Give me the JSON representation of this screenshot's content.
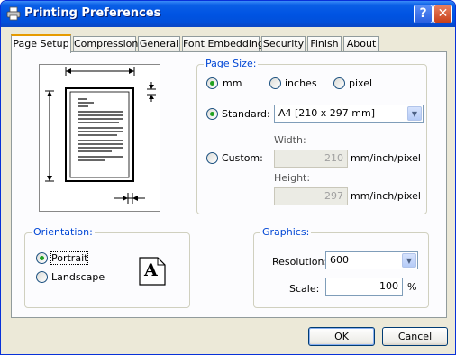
{
  "window": {
    "title": "Printing Preferences",
    "help_glyph": "?",
    "close_glyph": "✕"
  },
  "tabs": [
    {
      "label": "Page Setup",
      "active": true
    },
    {
      "label": "Compression"
    },
    {
      "label": "General"
    },
    {
      "label": "Font Embedding"
    },
    {
      "label": "Security"
    },
    {
      "label": "Finish"
    },
    {
      "label": "About"
    }
  ],
  "page_size": {
    "group_label": "Page Size:",
    "unit_options": [
      {
        "label": "mm",
        "checked": true
      },
      {
        "label": "inches",
        "checked": false
      },
      {
        "label": "pixel",
        "checked": false
      }
    ],
    "standard_label": "Standard:",
    "standard_checked": true,
    "standard_value": "A4 [210 x 297 mm]",
    "custom_label": "Custom:",
    "custom_checked": false,
    "width_label": "Width:",
    "width_value": "210",
    "width_unit": "mm/inch/pixel",
    "height_label": "Height:",
    "height_value": "297",
    "height_unit": "mm/inch/pixel"
  },
  "orientation": {
    "group_label": "Orientation:",
    "portrait_label": "Portrait",
    "portrait_checked": true,
    "landscape_label": "Landscape",
    "landscape_checked": false,
    "preview_glyph": "A"
  },
  "graphics": {
    "group_label": "Graphics:",
    "resolution_label": "Resolution:",
    "resolution_value": "600",
    "scale_label": "Scale:",
    "scale_value": "100",
    "scale_unit": "%"
  },
  "buttons": {
    "ok": "OK",
    "cancel": "Cancel"
  }
}
